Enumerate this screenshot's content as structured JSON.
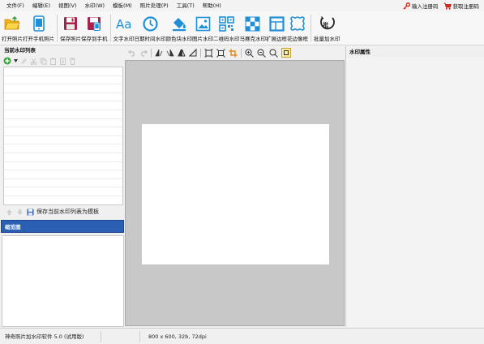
{
  "menu": [
    "文件(F)",
    "编辑(E)",
    "视图(V)",
    "水印(W)",
    "模板(M)",
    "照片处理(P)",
    "工具(T)",
    "帮助(H)"
  ],
  "menu_right": {
    "register": "输入注册码",
    "get_code": "获取注册码"
  },
  "toolbar": [
    "打开照片",
    "打开手机照片",
    "保存照片",
    "保存到手机",
    "文字水印",
    "日期时间水印",
    "颜色块水印",
    "图片水印",
    "二维码水印",
    "马赛克水印",
    "扩展边框",
    "花边像框",
    "批量加水印"
  ],
  "panels": {
    "watermark_list_title": "当前水印列表",
    "save_template_label": "保存当前水印列表为模板",
    "thumbnail_title": "缩览图",
    "properties_title": "水印属性"
  },
  "status": {
    "app": "神奇照片加水印软件 5.0 (试用版)",
    "image_info": "800 x 600, 32b, 72dpi"
  },
  "icons": {
    "toolbar": [
      "open-folder-icon",
      "phone-icon",
      "save-disk-icon",
      "save-to-phone-icon",
      "text-aa-icon",
      "clock-icon",
      "paint-bucket-icon",
      "image-icon",
      "qrcode-icon",
      "mosaic-icon",
      "border-icon",
      "flower-frame-icon",
      "batch-icon"
    ],
    "canvas_tools": [
      "undo-icon",
      "redo-icon",
      "flip-left-icon",
      "flip-right-icon",
      "mirror-h-icon",
      "rotate-icon",
      "fit-icon",
      "fullscreen-icon",
      "crop-icon",
      "zoom-in-icon",
      "zoom-out-icon",
      "zoom-icon",
      "actual-size-icon"
    ]
  },
  "colors": {
    "accent": "#2b5fb4",
    "canvas": "#c8c8c8",
    "key": "#e0281b",
    "cart": "#e0281b",
    "toolbar_blue": "#1f8fd8"
  }
}
